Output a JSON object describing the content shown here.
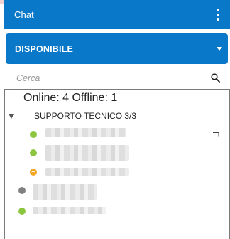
{
  "header": {
    "title": "Chat",
    "menu_icon": "kebab-vertical-icon"
  },
  "status": {
    "selected": "DISPONIBILE",
    "icon": "caret-down-icon"
  },
  "search": {
    "placeholder": "Cerca",
    "icon": "search-icon"
  },
  "roster": {
    "counts": "Online: 4 Offline: 1",
    "group": {
      "name": "SUPPORTO TECNICO 3/3",
      "icon": "triangle-down-icon"
    },
    "contacts": [
      {
        "status": "online",
        "color": "#8cc63e"
      },
      {
        "status": "online",
        "color": "#8cc63e"
      },
      {
        "status": "away",
        "color": "#f5a623"
      },
      {
        "status": "offline",
        "color": "#808080"
      },
      {
        "status": "online",
        "color": "#8cc63e"
      }
    ]
  },
  "colors": {
    "primary": "#0a78c8",
    "online": "#8cc63e",
    "away": "#f5a623",
    "offline": "#808080"
  }
}
